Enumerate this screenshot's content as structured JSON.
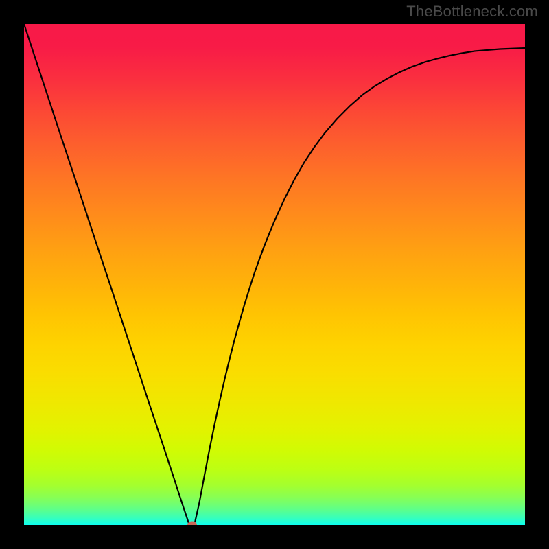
{
  "watermark": "TheBottleneck.com",
  "colors": {
    "background": "#000000",
    "curve_stroke": "#000000",
    "marker_fill": "#c96758"
  },
  "chart_data": {
    "type": "line",
    "title": "",
    "xlabel": "",
    "ylabel": "",
    "xlim": [
      0,
      1
    ],
    "ylim": [
      0,
      1
    ],
    "series": [
      {
        "name": "curve",
        "x": [
          0.0,
          0.025,
          0.05,
          0.075,
          0.1,
          0.125,
          0.15,
          0.175,
          0.2,
          0.225,
          0.25,
          0.275,
          0.3,
          0.31,
          0.32,
          0.33,
          0.34,
          0.35,
          0.36,
          0.37,
          0.38,
          0.39,
          0.4,
          0.41,
          0.42,
          0.43,
          0.44,
          0.45,
          0.46,
          0.47,
          0.48,
          0.49,
          0.5,
          0.52,
          0.54,
          0.56,
          0.58,
          0.6,
          0.625,
          0.65,
          0.675,
          0.7,
          0.725,
          0.75,
          0.775,
          0.8,
          0.825,
          0.85,
          0.875,
          0.9,
          0.925,
          0.95,
          0.975,
          1.0
        ],
        "y": [
          1.0,
          0.924,
          0.848,
          0.772,
          0.697,
          0.621,
          0.545,
          0.47,
          0.394,
          0.318,
          0.242,
          0.167,
          0.091,
          0.06,
          0.03,
          0.0,
          0.0,
          0.045,
          0.098,
          0.15,
          0.199,
          0.245,
          0.289,
          0.33,
          0.369,
          0.405,
          0.44,
          0.472,
          0.503,
          0.531,
          0.558,
          0.583,
          0.607,
          0.651,
          0.69,
          0.725,
          0.755,
          0.782,
          0.811,
          0.836,
          0.858,
          0.876,
          0.891,
          0.904,
          0.915,
          0.924,
          0.931,
          0.937,
          0.942,
          0.946,
          0.948,
          0.95,
          0.951,
          0.952
        ]
      }
    ],
    "marker": {
      "x": 0.335,
      "y": 0.0
    }
  }
}
